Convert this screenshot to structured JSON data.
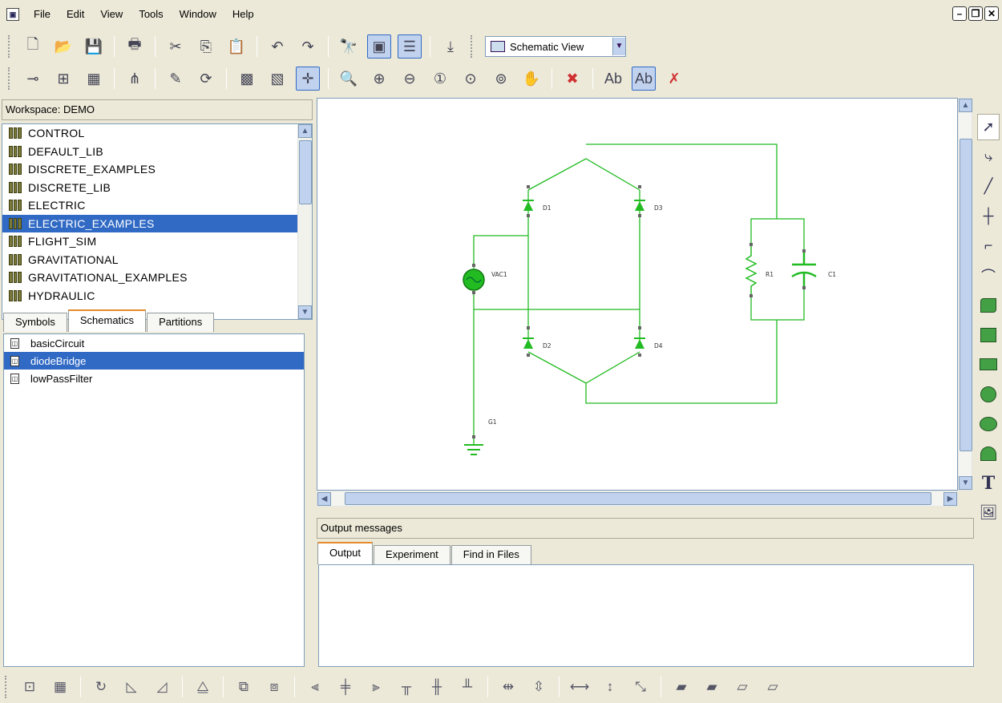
{
  "menu": {
    "items": [
      "File",
      "Edit",
      "View",
      "Tools",
      "Window",
      "Help"
    ]
  },
  "window_buttons": [
    "minimize",
    "restore",
    "close"
  ],
  "toolbar1": {
    "view_select": "Schematic View"
  },
  "workspace": {
    "title": "Workspace: DEMO",
    "libraries": [
      "CONTROL",
      "DEFAULT_LIB",
      "DISCRETE_EXAMPLES",
      "DISCRETE_LIB",
      "ELECTRIC",
      "ELECTRIC_EXAMPLES",
      "FLIGHT_SIM",
      "GRAVITATIONAL",
      "GRAVITATIONAL_EXAMPLES",
      "HYDRAULIC"
    ],
    "selected_library": "ELECTRIC_EXAMPLES",
    "tabs": [
      "Symbols",
      "Schematics",
      "Partitions"
    ],
    "active_tab": "Schematics",
    "schematics": [
      "basicCircuit",
      "diodeBridge",
      "lowPassFilter"
    ],
    "selected_schematic": "diodeBridge"
  },
  "schematic": {
    "labels": {
      "d1": "D1",
      "d2": "D2",
      "d3": "D3",
      "d4": "D4",
      "vac1": "VAC1",
      "r1": "R1",
      "c1": "C1",
      "g1": "G1"
    },
    "wire_color": "#22bb22"
  },
  "output": {
    "title": "Output messages",
    "tabs": [
      "Output",
      "Experiment",
      "Find in Files"
    ],
    "active_tab": "Output"
  },
  "colors": {
    "selection": "#316ac5",
    "wire": "#22bb22",
    "active_tab_accent": "#e68b2c"
  }
}
